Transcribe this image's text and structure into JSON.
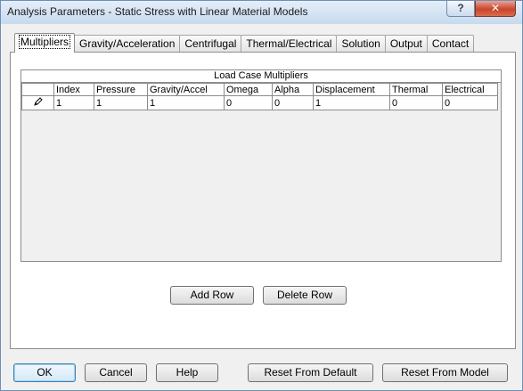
{
  "window": {
    "title": "Analysis Parameters - Static Stress with Linear Material Models",
    "help_glyph": "?",
    "close_glyph": "✕"
  },
  "tabs": [
    {
      "label": "Multipliers",
      "active": true
    },
    {
      "label": "Gravity/Acceleration",
      "active": false
    },
    {
      "label": "Centrifugal",
      "active": false
    },
    {
      "label": "Thermal/Electrical",
      "active": false
    },
    {
      "label": "Solution",
      "active": false
    },
    {
      "label": "Output",
      "active": false
    },
    {
      "label": "Contact",
      "active": false
    }
  ],
  "grid": {
    "title": "Load Case Multipliers",
    "columns": [
      "Index",
      "Pressure",
      "Gravity/Accel",
      "Omega",
      "Alpha",
      "Displacement",
      "Thermal",
      "Electrical"
    ],
    "rows": [
      [
        "1",
        "1",
        "1",
        "0",
        "0",
        "1",
        "0",
        "0"
      ]
    ],
    "selector_icon": "pencil-icon"
  },
  "panel_buttons": {
    "add_row": "Add Row",
    "delete_row": "Delete Row"
  },
  "footer_buttons": {
    "ok": "OK",
    "cancel": "Cancel",
    "help": "Help",
    "reset_default": "Reset From Default",
    "reset_model": "Reset From Model"
  }
}
